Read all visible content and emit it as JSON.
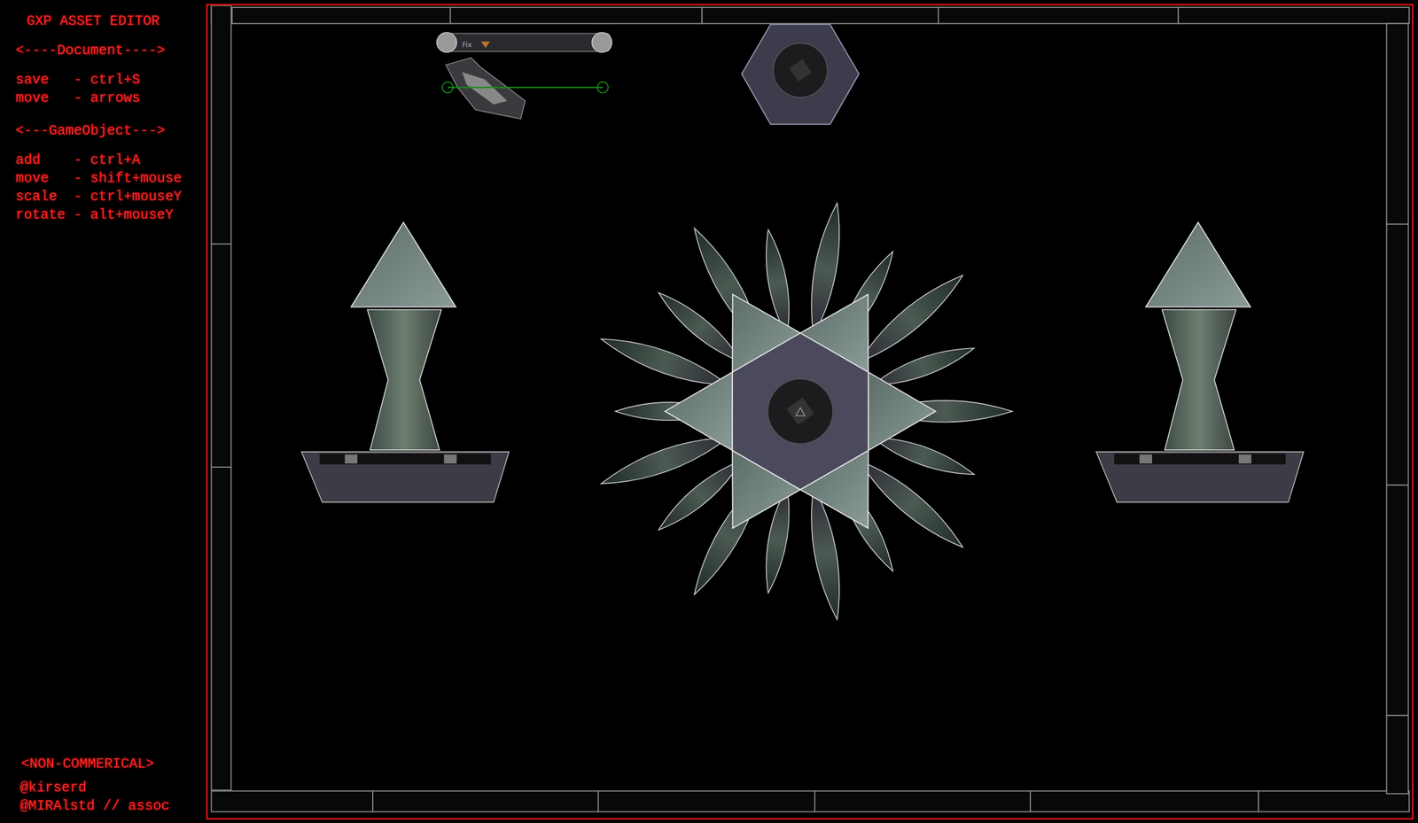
{
  "sidebar": {
    "title": "GXP ASSET EDITOR",
    "sections": [
      {
        "header": "<----Document---->",
        "shortcuts": [
          "save   - ctrl+S",
          "move   - arrows"
        ]
      },
      {
        "header": "<---GameObject--->",
        "shortcuts": [
          "add    - ctrl+A",
          "move   - shift+mouse",
          "scale  - ctrl+mouseY",
          "rotate - alt+mouseY"
        ]
      }
    ],
    "footer": {
      "license": "<NON-COMMERICAL>",
      "credits": [
        "@kirserd",
        "@MIRAlstd // assoc"
      ]
    }
  },
  "canvas": {
    "gadget_label": "Fix"
  }
}
